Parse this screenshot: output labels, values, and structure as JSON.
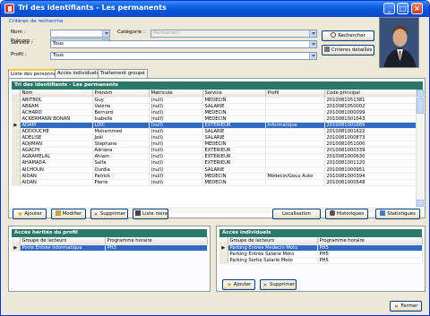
{
  "window": {
    "title": "Tri des identifiants - Les permanents"
  },
  "criteria": {
    "legend": "Critères de recherche",
    "nom_label": "Nom :",
    "nom_value": "",
    "prenom_label": "Prénom :",
    "prenom_value": "",
    "categorie_label": "Catégorie :",
    "categorie_value": "Permanent",
    "service_label": "Service :",
    "service_value": "Tous",
    "profil_label": "Profil :",
    "profil_value": "Tous",
    "search_button": "Rechercher",
    "detail_button": "Critères détaillés"
  },
  "tabs": [
    "Liste des personnes",
    "Accès individuels",
    "Traitement groupé"
  ],
  "grid": {
    "title": "Tri des identifiants - Les permanents",
    "columns": [
      "Nom",
      "Prénom",
      "Matricule",
      "Service",
      "Profil",
      "Code principal"
    ],
    "rows": [
      [
        "ABITBOL",
        "Guy",
        "(null)",
        "MEDECIN",
        "",
        "2010081051381"
      ],
      [
        "ABRAM",
        "Valérie",
        "(null)",
        "SALARIE",
        "",
        "2010081050002"
      ],
      [
        "ACHARD",
        "Bernard",
        "(null)",
        "MEDECIN",
        "",
        "2010081000099"
      ],
      [
        "ACKERMANN BONAN",
        "Isabelle",
        "(null)",
        "MEDECIN",
        "",
        "2010081001643"
      ],
      [
        "ADAM",
        "LOIC",
        "(null)",
        "EXTERIEUR",
        "Informatique",
        "2010081001689"
      ],
      [
        "ADDOUCHE",
        "Mohammed",
        "(null)",
        "SALARIE",
        "",
        "2010081001622"
      ],
      [
        "ADELISE",
        "Joël",
        "(null)",
        "SALARIE",
        "",
        "2010081000873"
      ],
      [
        "ADJIMAN",
        "Stéphane",
        "(null)",
        "MEDECIN",
        "",
        "2010081051000"
      ],
      [
        "AGACHI",
        "Adriana",
        "(null)",
        "EXTERIEUR",
        "",
        "2010081000339"
      ],
      [
        "AGRAMELAL",
        "Ahlam",
        "(null)",
        "EXTERIEUR",
        "",
        "2010081000630"
      ],
      [
        "AHAMADA",
        "Salfa",
        "(null)",
        "EXTERIEUR",
        "",
        "2010081001120"
      ],
      [
        "AICHOUN",
        "Ourdia",
        "(null)",
        "SALARIE",
        "",
        "2010081000951"
      ],
      [
        "AIDAN",
        "Patrick",
        "(null)",
        "MEDECIN",
        "Médecin/Gouv Auto",
        "2010081000394"
      ],
      [
        "AIDAN",
        "Pierre",
        "(null)",
        "MEDECIN",
        "",
        "2010081000548"
      ]
    ],
    "selected_index": 4
  },
  "grid_actions": {
    "add": "Ajouter",
    "modify": "Modifier",
    "delete": "Supprimer",
    "print": "Liste noire",
    "localisation": "Localisation",
    "historiques": "Historiques",
    "statistiques": "Statistiques"
  },
  "profile_access": {
    "title": "Accès hérités du profil",
    "columns": [
      "Groupe de lecteurs",
      "Programme horaire"
    ],
    "rows": [
      [
        "Porte Entrée Informatique",
        "PH3"
      ]
    ]
  },
  "individual_access": {
    "title": "Accès individuels",
    "columns": [
      "Groupe de lecteurs",
      "Programme horaire"
    ],
    "rows": [
      [
        "Parking Entrée Medecin Moto",
        "PH5"
      ],
      [
        "Parking Entrée Salarié Moto",
        "PH5"
      ],
      [
        "Parking Sortie Salarié Moto",
        "PH5"
      ]
    ],
    "add": "Ajouter",
    "delete": "Supprimer"
  },
  "footer": {
    "close": "Fermer"
  },
  "colors": {
    "title_bar": "#0b5ee0",
    "grid_header": "#2d7766",
    "selection": "#316ac5"
  },
  "icons": [
    "app-icon",
    "search-icon",
    "criteria-icon",
    "star-icon",
    "pencil-icon",
    "delete-icon",
    "print-icon",
    "binoculars-icon",
    "close-icon"
  ]
}
